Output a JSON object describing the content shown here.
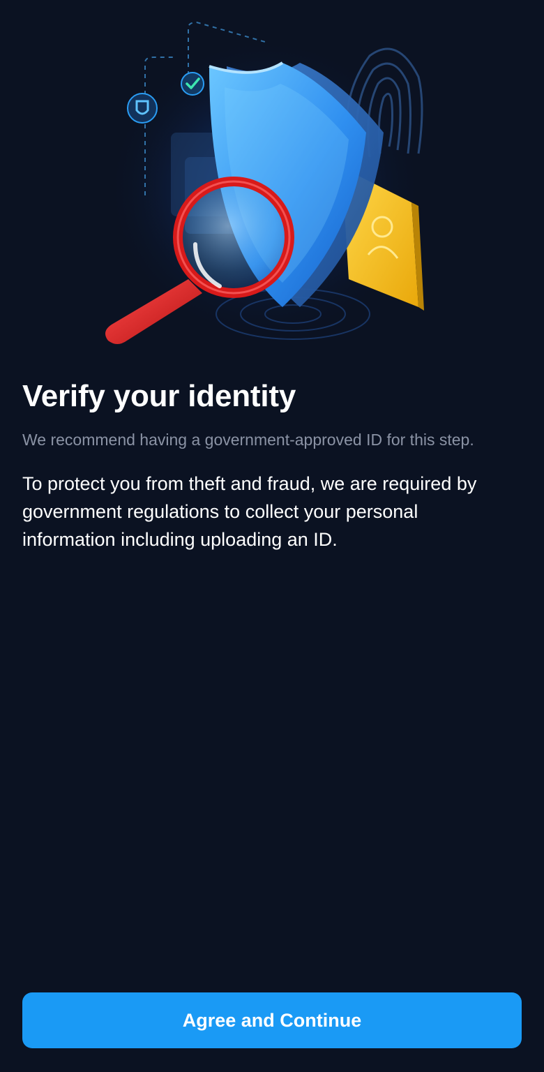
{
  "onboarding": {
    "illustration": {
      "icons": [
        "shield-icon",
        "magnifying-glass-icon",
        "fingerprint-icon",
        "id-card-icon",
        "checkmark-badge-icon",
        "small-shield-badge-icon"
      ]
    },
    "title": "Verify your identity",
    "subtitle": "We recommend having a government-approved ID for this step.",
    "body": "To protect you from theft and fraud, we are required by government regulations to collect your personal information including uploading an ID.",
    "primary_button_label": "Agree and Continue"
  },
  "colors": {
    "background": "#0b1222",
    "accent": "#1a9af5",
    "subtitle_text": "#8b93a5",
    "shield_blue": "#4cb4ff",
    "magnifier_red": "#e21f1f",
    "card_yellow": "#f7c21b"
  }
}
